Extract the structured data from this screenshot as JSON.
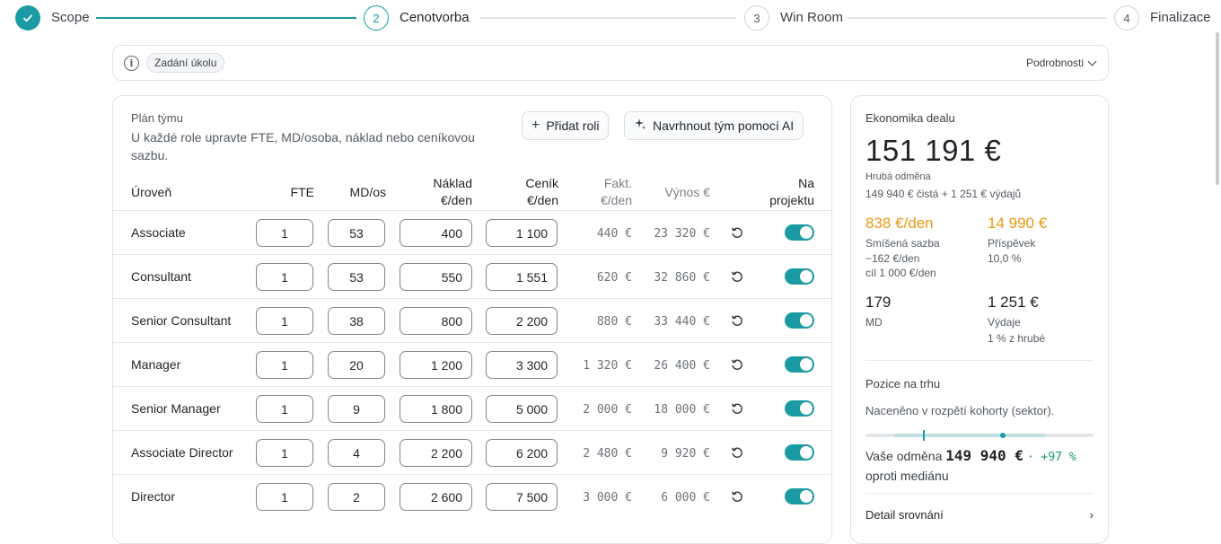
{
  "stepper": {
    "steps": [
      {
        "number": "1",
        "label": "Scope",
        "state": "done"
      },
      {
        "number": "2",
        "label": "Cenotvorba",
        "state": "active"
      },
      {
        "number": "3",
        "label": "Win Room",
        "state": "todo"
      },
      {
        "number": "4",
        "label": "Finalizace",
        "state": "todo"
      }
    ]
  },
  "task": {
    "info_icon": "info-icon",
    "chip_label": "Zadání úkolu",
    "details_label": "Podrobnosti"
  },
  "team": {
    "title": "Plán týmu",
    "description": "U každé role upravte FTE, MD/osoba, náklad nebo ceníkovou sazbu.",
    "add_role_label": "Přidat roli",
    "ai_label": "Navrhnout tým pomocí AI",
    "columns": {
      "level": "Úroveň",
      "fte": "FTE",
      "md": "MD/os",
      "cost_1": "Náklad",
      "cost_2": "€/den",
      "price_1": "Ceník",
      "price_2": "€/den",
      "fakt_1": "Fakt.",
      "fakt_2": "€/den",
      "revenue": "Výnos €",
      "on_project_1": "Na",
      "on_project_2": "projektu"
    },
    "rows": [
      {
        "role": "Associate",
        "fte": "1",
        "md": "53",
        "cost": "400",
        "price": "1 100",
        "fakt": "440 €",
        "revenue": "23 320 €",
        "on_project": true
      },
      {
        "role": "Consultant",
        "fte": "1",
        "md": "53",
        "cost": "550",
        "price": "1 551",
        "fakt": "620 €",
        "revenue": "32 860 €",
        "on_project": true
      },
      {
        "role": "Senior Consultant",
        "fte": "1",
        "md": "38",
        "cost": "800",
        "price": "2 200",
        "fakt": "880 €",
        "revenue": "33 440 €",
        "on_project": true
      },
      {
        "role": "Manager",
        "fte": "1",
        "md": "20",
        "cost": "1 200",
        "price": "3 300",
        "fakt": "1 320 €",
        "revenue": "26 400 €",
        "on_project": true
      },
      {
        "role": "Senior Manager",
        "fte": "1",
        "md": "9",
        "cost": "1 800",
        "price": "5 000",
        "fakt": "2 000 €",
        "revenue": "18 000 €",
        "on_project": true
      },
      {
        "role": "Associate Director",
        "fte": "1",
        "md": "4",
        "cost": "2 200",
        "price": "6 200",
        "fakt": "2 480 €",
        "revenue": "9 920 €",
        "on_project": true
      },
      {
        "role": "Director",
        "fte": "1",
        "md": "2",
        "cost": "2 600",
        "price": "7 500",
        "fakt": "3 000 €",
        "revenue": "6 000 €",
        "on_project": true
      }
    ]
  },
  "economics": {
    "title": "Ekonomika dealu",
    "gross_value": "151 191 €",
    "gross_label": "Hrubá odměna",
    "gross_breakdown": "149 940 € čistá + 1 251 € výdajů",
    "blended_rate": "838 €/den",
    "blended_label": "Smíšená sazba",
    "blended_diff": "−162 €/den",
    "blended_target": "cíl 1 000 €/den",
    "contribution": "14 990 €",
    "contribution_label": "Příspěvek",
    "contribution_pct": "10,0 %",
    "md_value": "179",
    "md_label": "MD",
    "expenses_value": "1 251 €",
    "expenses_label": "Výdaje",
    "expenses_pct": "1 % z hrubé",
    "market_title": "Pozice na trhu",
    "market_desc": "Naceněno v rozpětí kohorty (sektor).",
    "your_fee_label": "Vaše odměna",
    "your_fee_value": "149 940 €",
    "your_fee_delta": "· +97 %",
    "vs_median": "oproti mediánu",
    "detail_link": "Detail srovnání",
    "accent_color": "#1a9ba3",
    "warn_color": "#e89a10"
  }
}
